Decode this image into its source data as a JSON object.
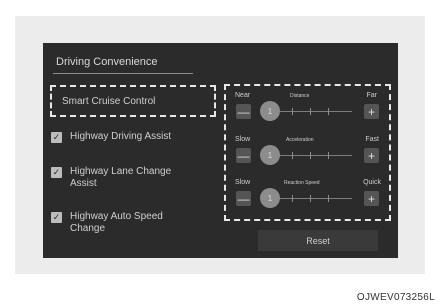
{
  "screen": {
    "title": "Driving Convenience",
    "left_items": [
      {
        "label": "Smart Cruise Control",
        "type": "selected"
      },
      {
        "label": "Highway Driving Assist",
        "checked": true
      },
      {
        "label": "Highway Lane Change\nAssist",
        "checked": true
      },
      {
        "label": "Highway Auto Speed\nChange",
        "checked": true
      }
    ],
    "sliders": [
      {
        "left": "Near",
        "center": "Distance",
        "right": "Far",
        "value": 1
      },
      {
        "left": "Slow",
        "center": "Acceleration",
        "right": "Fast",
        "value": 1
      },
      {
        "left": "Slow",
        "center": "Reaction Speed",
        "right": "Quick",
        "value": 1
      }
    ],
    "minus_symbol": "—",
    "plus_symbol": "+",
    "reset_label": "Reset"
  },
  "image_code": "OJWEV073256L",
  "colors": {
    "background": "#ececec",
    "screen": "#2b2b2b",
    "dashed_border": "#e8e8e8"
  }
}
